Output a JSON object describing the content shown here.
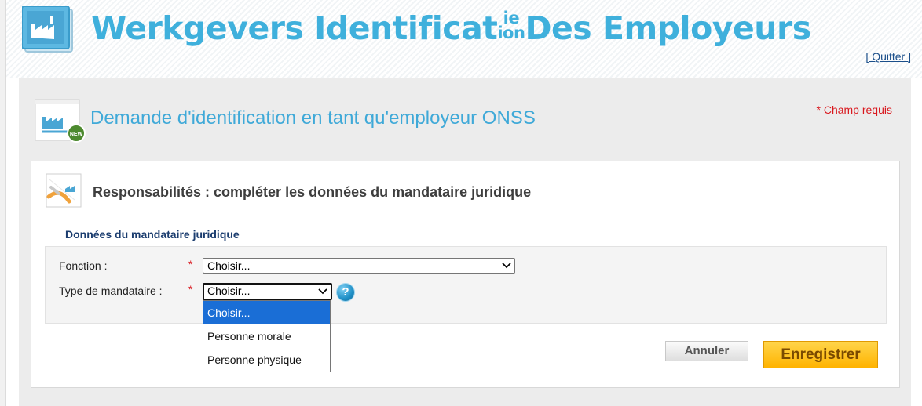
{
  "header": {
    "title_part1": "Werkgevers Identificat",
    "title_sup": "ie",
    "title_sub": "ion",
    "title_part2": " Des Employeurs",
    "quit_link": "[ Quitter ]"
  },
  "page": {
    "title": "Demande d'identification en tant qu'employeur ONSS",
    "required_note": "* Champ requis",
    "page_icon_badge": "NEW"
  },
  "section": {
    "title": "Responsabilités : compléter les données du mandataire juridique",
    "group_title": "Données du mandataire juridique"
  },
  "form": {
    "fonction_label": "Fonction :",
    "fonction_required": "*",
    "fonction_value": "Choisir...",
    "type_label": "Type de mandataire :",
    "type_required": "*",
    "type_value": "Choisir...",
    "help_icon": "?",
    "type_options": [
      "Choisir...",
      "Personne morale",
      "Personne physique"
    ]
  },
  "buttons": {
    "cancel": "Annuler",
    "save": "Enregistrer"
  },
  "colors": {
    "title_blue": "#3fb0dc",
    "required_red": "#d9171d",
    "selected_option": "#1a6ed6",
    "save_orange": "#ffb300"
  }
}
